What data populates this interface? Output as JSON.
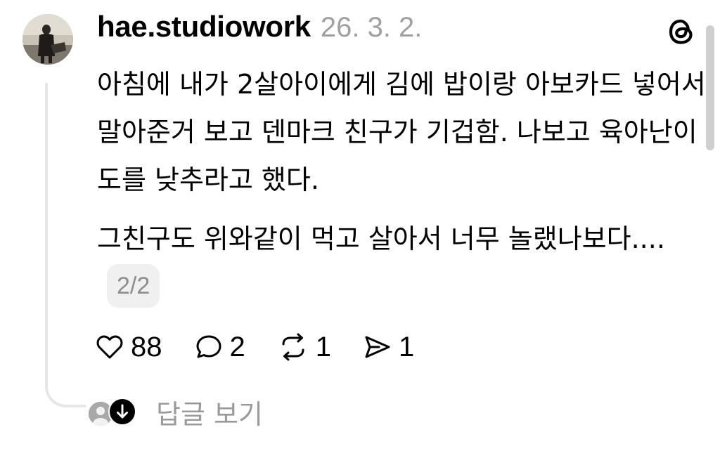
{
  "post": {
    "username": "hae.studiowork",
    "timestamp": "26. 3. 2.",
    "paragraphs": [
      "아침에 내가 2살아이에게 김에 밥이랑 아보카드 넣어서 말아준거 보고 덴마크 친구가 기겁함. 나보고 육아난이도를 낮추라고 했다.",
      "그친구도 위와같이 먹고 살아서 너무 놀랬나보다...."
    ],
    "pager": "2/2"
  },
  "actions": {
    "like_count": "88",
    "comment_count": "2",
    "repost_count": "1",
    "share_count": "1"
  },
  "replies": {
    "label": "답글 보기"
  },
  "icons": {
    "logo": "threads-logo-icon",
    "like": "heart-icon",
    "comment": "comment-bubble-icon",
    "repost": "repost-icon",
    "share": "send-icon",
    "expand": "arrow-down-icon"
  }
}
